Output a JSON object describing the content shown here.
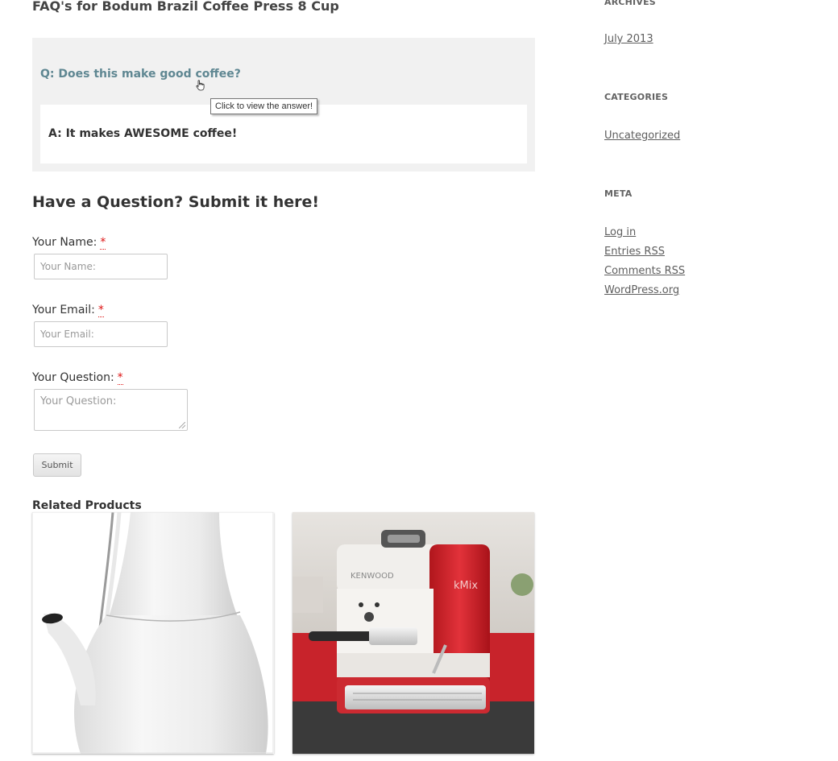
{
  "faq": {
    "title": "FAQ's for Bodum Brazil Coffee Press 8 Cup",
    "question": "Q: Does this make good coffee?",
    "tooltip": "Click to view the answer!",
    "answer": "A: It makes AWESOME coffee!"
  },
  "question_form": {
    "heading": "Have a Question? Submit it here!",
    "required_marker": "*",
    "name": {
      "label": "Your Name:",
      "placeholder": "Your Name:"
    },
    "email": {
      "label": "Your Email:",
      "placeholder": "Your Email:"
    },
    "question": {
      "label": "Your Question:",
      "placeholder": "Your Question:"
    },
    "submit_label": "Submit"
  },
  "related": {
    "heading": "Related Products",
    "products": [
      {
        "image": "white-ceramic-kettle"
      },
      {
        "image": "red-espresso-machine",
        "brand_text": "kMix"
      }
    ]
  },
  "sidebar": {
    "archives": {
      "title": "ARCHIVES",
      "links": [
        "July 2013"
      ]
    },
    "categories": {
      "title": "CATEGORIES",
      "links": [
        "Uncategorized"
      ]
    },
    "meta": {
      "title": "META",
      "links": [
        "Log in",
        "Entries RSS",
        "Comments RSS",
        "WordPress.org"
      ]
    }
  },
  "colors": {
    "question_link": "#5f8792",
    "faq_background": "#f1f1f1",
    "required_marker": "#dd1111",
    "espresso_red": "#d4262c"
  }
}
